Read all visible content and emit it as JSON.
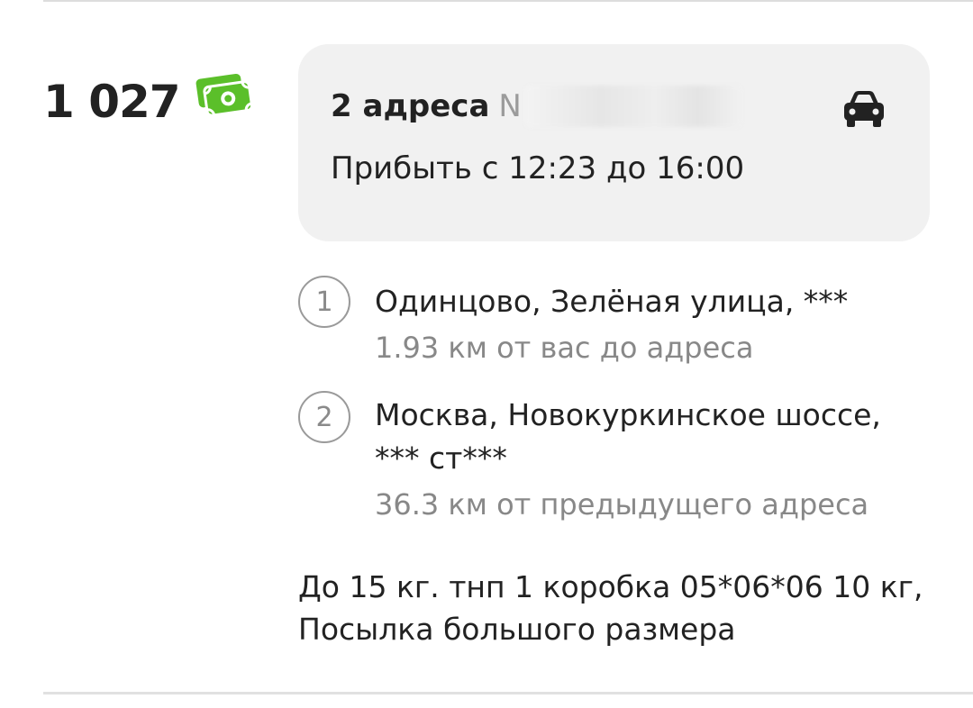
{
  "price": {
    "amount": "1 027",
    "icon": "cash-icon",
    "icon_color": "#5bbf2a"
  },
  "order_card": {
    "title": "2 адреса",
    "title_suffix": "N",
    "arrival": "Прибыть с 12:23 до 16:00",
    "vehicle_icon": "car-icon",
    "background": "#f1f1f1"
  },
  "addresses": [
    {
      "number": "1",
      "line1": "Одинцово, Зелёная улица, ***",
      "distance": "1.93 км от вас до адреса"
    },
    {
      "number": "2",
      "line1": "Москва, Новокуркинское шоссе,",
      "line2": "*** ст***",
      "distance": "36.3 км от предыдущего адреса"
    }
  ],
  "cargo": {
    "line1": "До 15 кг. тнп 1 коробка 05*06*06 10 кг,",
    "line2": "Посылка большого размера"
  }
}
